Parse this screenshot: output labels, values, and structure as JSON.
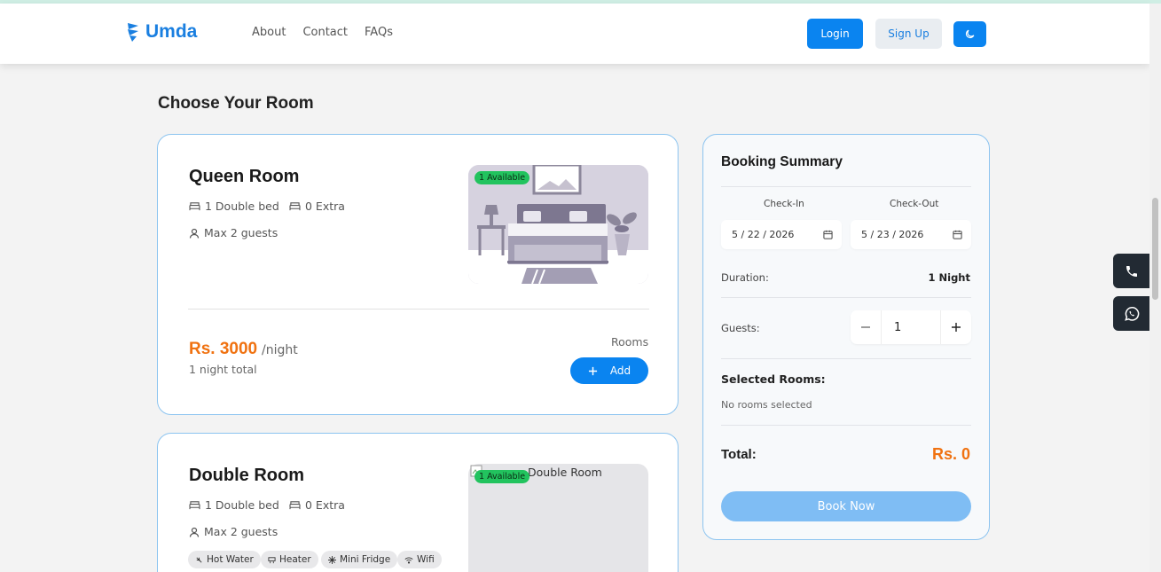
{
  "nav": {
    "brand": "Umda",
    "links": [
      "About",
      "Contact",
      "FAQs"
    ],
    "login": "Login",
    "signup": "Sign Up"
  },
  "page_title": "Choose Your Room",
  "rooms": [
    {
      "name": "Queen Room",
      "bed": "1 Double bed",
      "extra": "0 Extra",
      "guests": "Max 2 guests",
      "availability": "1 Available",
      "price": "Rs. 3000",
      "per_night": "/night",
      "total_note": "1 night total",
      "rooms_label": "Rooms",
      "add_label": "Add"
    },
    {
      "name": "Double Room",
      "bed": "1 Double bed",
      "extra": "0 Extra",
      "guests": "Max 2 guests",
      "availability": "1 Available",
      "image_alt": "Double Room",
      "amenities": [
        "Hot Water",
        "Heater",
        "Mini Fridge",
        "Wifi"
      ]
    }
  ],
  "summary": {
    "title": "Booking Summary",
    "checkin_label": "Check-In",
    "checkout_label": "Check-Out",
    "checkin": "5 / 22 / 2026",
    "checkout": "5 / 23 / 2026",
    "duration_label": "Duration:",
    "duration": "1 Night",
    "guests_label": "Guests:",
    "guests": "1",
    "selected_title": "Selected Rooms:",
    "selected_none": "No rooms selected",
    "total_label": "Total:",
    "total": "Rs. 0",
    "book": "Book Now"
  },
  "colors": {
    "primary": "#0a84f0",
    "accent_price": "#f07211",
    "available_badge": "#22c35e",
    "card_border": "#8cc4f0"
  },
  "icons": [
    "logo-icon",
    "moon-icon",
    "bed-icon",
    "sofa-icon",
    "user-icon",
    "calendar-icon",
    "minus-icon",
    "plus-icon",
    "phone-icon",
    "whatsapp-icon"
  ]
}
